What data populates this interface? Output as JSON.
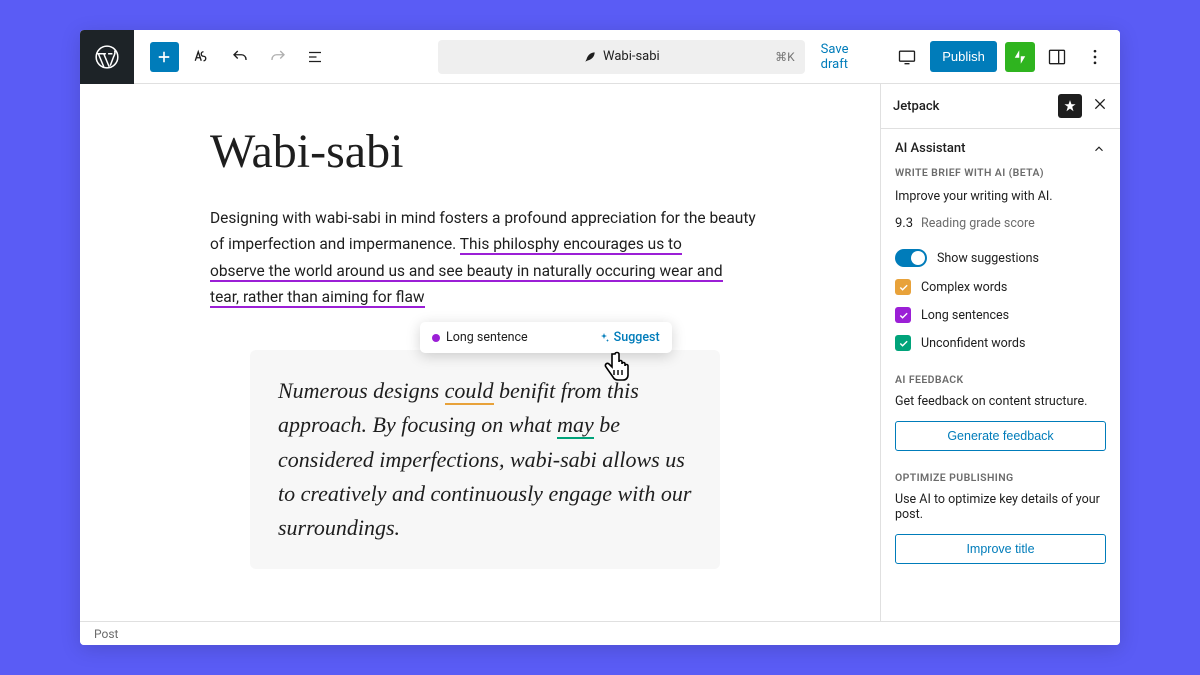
{
  "toolbar": {
    "title": "Wabi-sabi",
    "kbd": "⌘K",
    "save_draft": "Save draft",
    "publish": "Publish"
  },
  "post": {
    "title": "Wabi-sabi",
    "para_lead": "Designing with wabi-sabi in mind fosters a profound appreciation for the beauty of imperfection and impermanence. ",
    "long1": "This philosphy encourages us to",
    "long2": "observe the world around us and see beauty in naturally occuring wear and",
    "long3": "tear, rather than aiming for flaw",
    "quote_pre": "Numerous designs ",
    "quote_could": "could",
    "quote_mid1": " benifit from this approach. By focusing on what ",
    "quote_may": "may",
    "quote_rest": " be considered imperfections, wabi-sabi allows us to creatively and continuously engage with our surroundings."
  },
  "popover": {
    "label": "Long sentence",
    "action": "Suggest"
  },
  "sidebar": {
    "panel_title": "Jetpack",
    "section": "AI Assistant",
    "write_brief_label": "WRITE BRIEF WITH AI (BETA)",
    "improve_line": "Improve your writing with AI.",
    "score": "9.3",
    "score_label": "Reading grade score",
    "show_suggestions": "Show suggestions",
    "complex_words": "Complex words",
    "long_sentences": "Long sentences",
    "unconfident_words": "Unconfident words",
    "ai_feedback_h": "AI FEEDBACK",
    "ai_feedback_line": "Get feedback on content structure.",
    "generate_feedback": "Generate feedback",
    "optimize_h": "OPTIMIZE PUBLISHING",
    "optimize_line": "Use AI to optimize key details of your post.",
    "improve_title": "Improve title"
  },
  "footer": {
    "breadcrumb": "Post"
  }
}
